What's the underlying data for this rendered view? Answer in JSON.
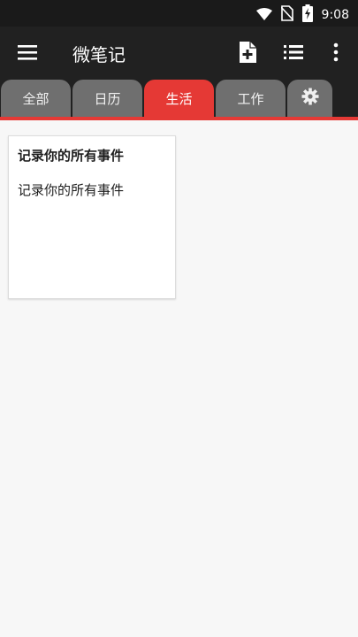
{
  "status_bar": {
    "time": "9:08",
    "icons": [
      "wifi-icon",
      "no-sim-icon",
      "battery-charging-icon"
    ]
  },
  "toolbar": {
    "title": "微笔记",
    "menu_icon": "hamburger-menu-icon",
    "actions": [
      "new-note-icon",
      "list-view-icon",
      "more-vert-icon"
    ]
  },
  "tabs": [
    {
      "label": "全部",
      "active": false
    },
    {
      "label": "日历",
      "active": false
    },
    {
      "label": "生活",
      "active": true
    },
    {
      "label": "工作",
      "active": false
    }
  ],
  "settings_tab_icon": "gear-icon",
  "notes": [
    {
      "title": "记录你的所有事件",
      "body": "记录你的所有事件"
    }
  ],
  "colors": {
    "accent": "#e53935",
    "toolbar": "#212121",
    "tab_inactive": "#6f6f6f",
    "background": "#f7f7f7"
  }
}
